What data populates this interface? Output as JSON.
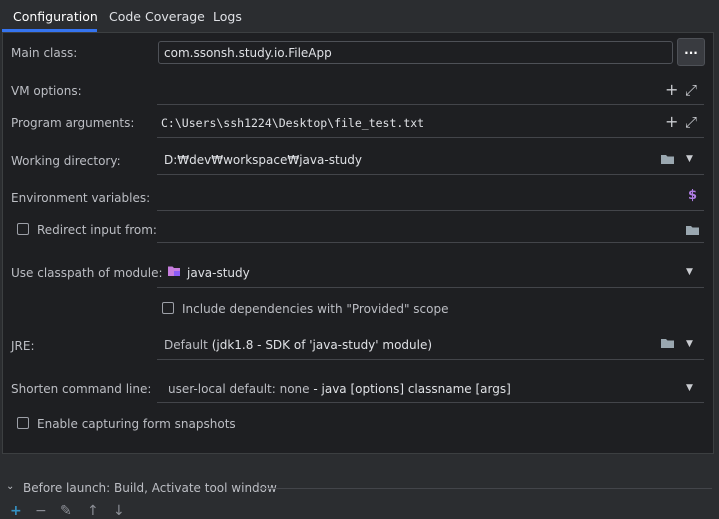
{
  "tabs": [
    {
      "label": "Configuration"
    },
    {
      "label": "Code Coverage"
    },
    {
      "label": "Logs"
    }
  ],
  "fields": {
    "main_class": {
      "label": "Main class:",
      "value": "com.ssonsh.study.io.FileApp",
      "button": "..."
    },
    "vm_options": {
      "label": "VM options:",
      "value": ""
    },
    "program_arguments": {
      "label": "Program arguments:",
      "value": "C:\\Users\\ssh1224\\Desktop\\file_test.txt"
    },
    "working_directory": {
      "label": "Working directory:",
      "value": "D:₩dev₩workspace₩java-study"
    },
    "environment_variables": {
      "label": "Environment variables:",
      "value": ""
    },
    "redirect_input": {
      "label": "Redirect input from:",
      "checked": false,
      "value": ""
    },
    "classpath_module": {
      "label": "Use classpath of module:",
      "value": "java-study"
    },
    "include_provided": {
      "label": "Include dependencies with \"Provided\" scope",
      "checked": false
    },
    "jre": {
      "label": "JRE:",
      "value_prefix": "Default",
      "value_detail": "(jdk1.8 - SDK of 'java-study' module)"
    },
    "shorten_command_line": {
      "label": "Shorten command line:",
      "value_prefix": "user-local default: none",
      "value_detail": "- java [options] classname [args]"
    },
    "form_snapshots": {
      "label": "Enable capturing form snapshots",
      "checked": false
    }
  },
  "before_launch": {
    "label": "Before launch: Build, Activate tool window"
  },
  "icons": {
    "plus": "+",
    "expand": "⤢",
    "folder": "folder-icon",
    "dropdown": "▼",
    "dollar": "$",
    "module_folder": "module-folder-icon",
    "chevron": "chevron-down-icon",
    "toolbar": [
      "add-icon",
      "remove-icon",
      "edit-icon",
      "move-up-icon",
      "move-down-icon"
    ]
  },
  "colors": {
    "accent": "#3574f0",
    "dollar": "#b07de4",
    "module": "#c77dde",
    "add": "#3592c4"
  }
}
